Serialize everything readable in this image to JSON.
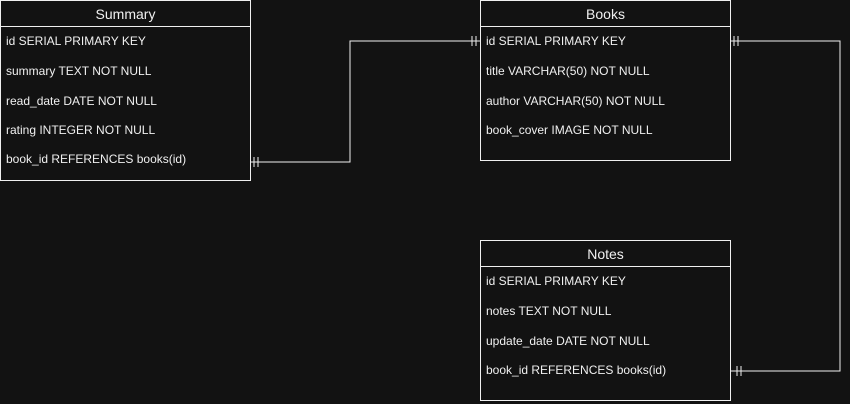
{
  "entities": {
    "summary": {
      "title": "Summary",
      "fields": [
        "id SERIAL PRIMARY KEY",
        "summary TEXT NOT NULL",
        "read_date DATE NOT NULL",
        "rating INTEGER NOT NULL",
        "book_id REFERENCES books(id)"
      ]
    },
    "books": {
      "title": "Books",
      "fields": [
        "id SERIAL PRIMARY KEY",
        "title VARCHAR(50) NOT NULL",
        "author VARCHAR(50) NOT NULL",
        "book_cover IMAGE NOT NULL"
      ]
    },
    "notes": {
      "title": "Notes",
      "fields": [
        "id SERIAL PRIMARY KEY",
        "notes TEXT NOT NULL",
        "update_date DATE NOT NULL",
        "book_id REFERENCES books(id)"
      ]
    }
  },
  "relationships": [
    {
      "from": "summary.book_id",
      "to": "books.id",
      "notation": "one-to-one"
    },
    {
      "from": "notes.book_id",
      "to": "books.id",
      "notation": "one-to-one"
    }
  ],
  "colors": {
    "background": "#121212",
    "stroke": "#f0f0f0",
    "text": "#f0f0f0"
  }
}
